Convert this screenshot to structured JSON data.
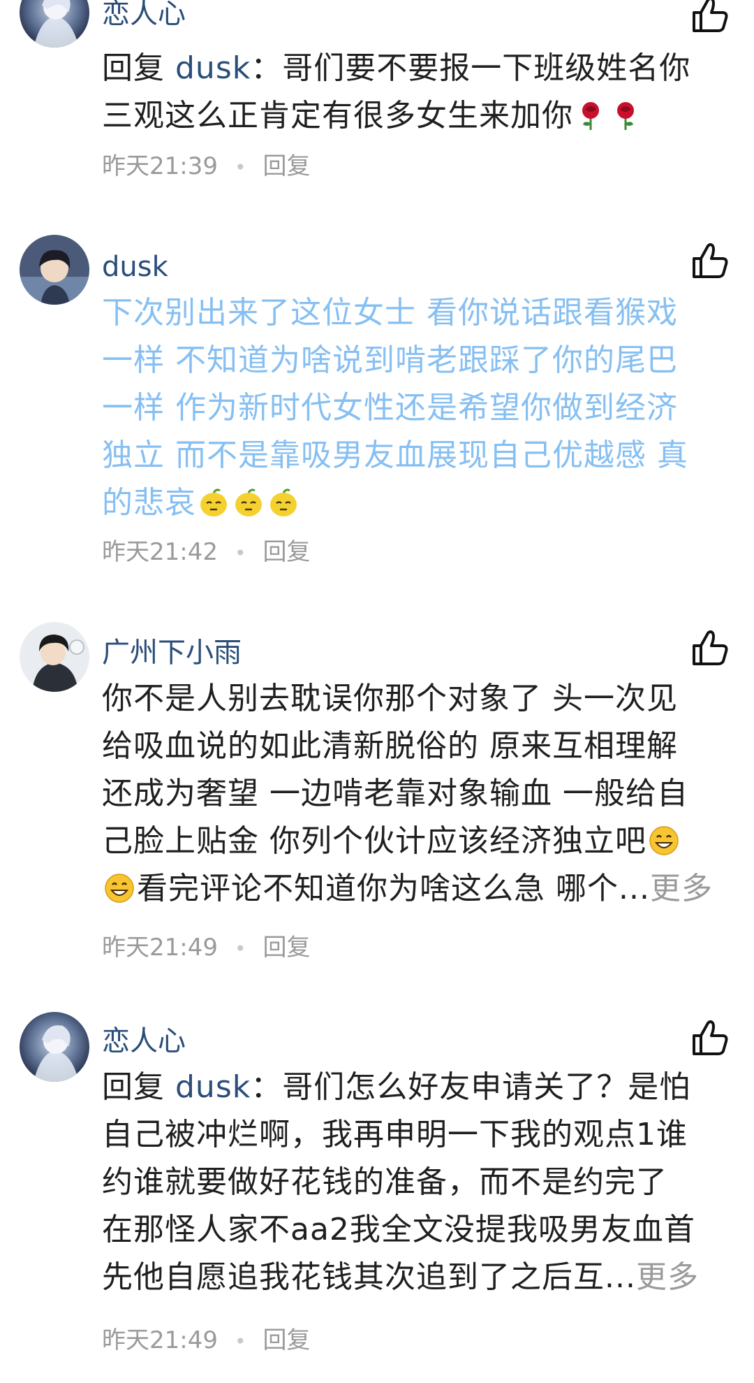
{
  "comments": [
    {
      "username": "恋人心",
      "reply_prefix": "回复 ",
      "reply_to": "dusk",
      "text_lines": [
        "：哥们要不要报一下班级姓名你",
        "三观这么正肯定有很多女生来加你"
      ],
      "emoji": [
        "rose",
        "rose"
      ],
      "time": "昨天21:39",
      "reply_label": "回复",
      "avatar": "anime-white-hair-avatar",
      "like_icon": "thumbs-up-icon"
    },
    {
      "username": "dusk",
      "text_lines": [
        "下次别出来了这位女士 看你说话跟看猴戏",
        "一样 不知道为啥说到啃老跟踩了你的尾巴",
        "一样 作为新时代女性还是希望你做到经济",
        "独立 而不是靠吸男友血展现自己优越感 真",
        "的悲哀"
      ],
      "emoji": [
        "lemon-face",
        "lemon-face",
        "lemon-face"
      ],
      "time": "昨天21:42",
      "reply_label": "回复",
      "avatar": "anime-dark-hair-avatar",
      "like_icon": "thumbs-up-icon",
      "text_color": "#86bff2"
    },
    {
      "username": "广州下小雨",
      "text_lines": [
        "你不是人别去耽误你那个对象了 头一次见",
        "给吸血说的如此清新脱俗的 原来互相理解",
        "还成为奢望  一边啃老靠对象输血 一般给自",
        "己脸上贴金  你列个伙计应该经济独立吧"
      ],
      "last_line": "看完评论不知道你为啥这么急 哪个...",
      "more_label": "更多",
      "emoji": [
        "grin",
        "grin"
      ],
      "time": "昨天21:49",
      "reply_label": "回复",
      "avatar": "anime-hoodie-avatar",
      "like_icon": "thumbs-up-icon"
    },
    {
      "username": "恋人心",
      "reply_prefix": "回复 ",
      "reply_to": "dusk",
      "text_lines": [
        "：哥们怎么好友申请关了？是怕",
        "自己被冲烂啊，我再申明一下我的观点1谁",
        "约谁就要做好花钱的准备，而不是约完了",
        "在那怪人家不aa2我全文没提我吸男友血首"
      ],
      "last_line": "先他自愿追我花钱其次追到了之后互...",
      "more_label": "更多",
      "time": "昨天21:49",
      "reply_label": "回复",
      "avatar": "anime-white-hair-avatar",
      "like_icon": "thumbs-up-icon"
    }
  ],
  "colors": {
    "username": "#2a4d7a",
    "body": "#1f1f1f",
    "meta": "#9a9a9a",
    "blue_text": "#86bff2"
  }
}
